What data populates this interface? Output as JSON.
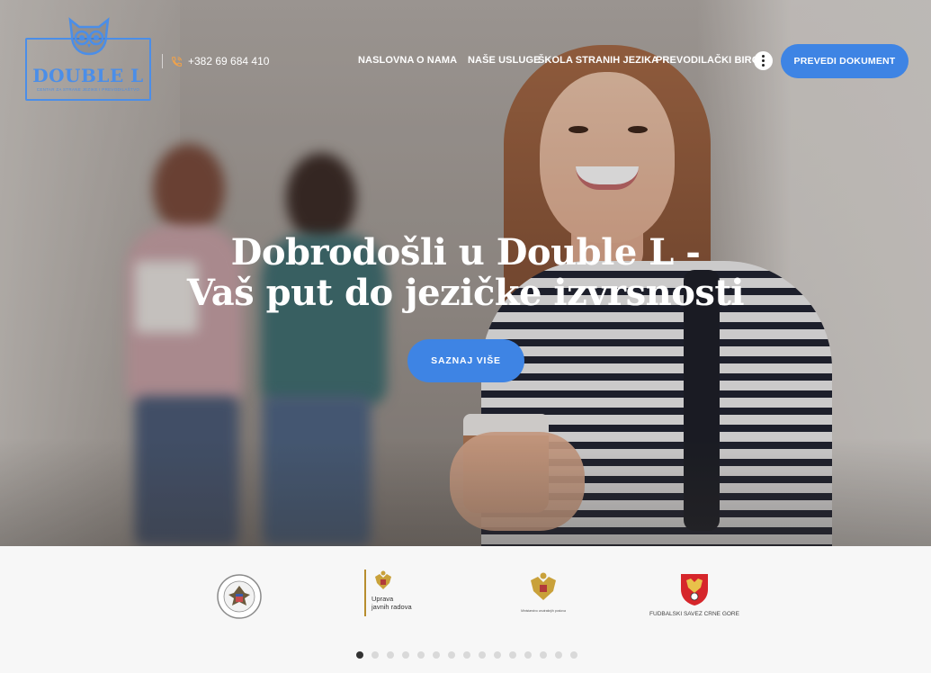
{
  "brand": {
    "name": "DOUBLE L",
    "tagline": "CENTAR ZA STRANE JEZIKE I PREVODILAŠTVO",
    "accent_color": "#3e84e4"
  },
  "header": {
    "phone_icon": "phone-icon",
    "phone": "+382 69 684 410",
    "nav": [
      "NASLOVNA",
      "O NAMA",
      "NAŠE USLUGE",
      "ŠKOLA STRANIH JEZIKA",
      "PREVODILAČKI BIRO"
    ],
    "more_icon": "more-vertical-icon",
    "cta_label": "PREVEDI DOKUMENT"
  },
  "hero": {
    "title_line1": "Dobrodošli u Double L -",
    "title_line2": "Vaš put do jezičke izvrsnosti",
    "button_label": "SAZNAJ VIŠE"
  },
  "partners": {
    "items": [
      {
        "icon": "us-embassy-seal-icon"
      },
      {
        "icon": "montenegro-coat-of-arms-icon",
        "label_line1": "Uprava",
        "label_line2": "javnih radova"
      },
      {
        "icon": "montenegro-coat-of-arms-icon",
        "label": "Ministarstvo unutrašnjih poslova"
      },
      {
        "icon": "football-association-crest-icon",
        "label": "FUDBALSKI SAVEZ CRNE GORE"
      }
    ],
    "slider": {
      "total": 15,
      "active": 1
    }
  }
}
